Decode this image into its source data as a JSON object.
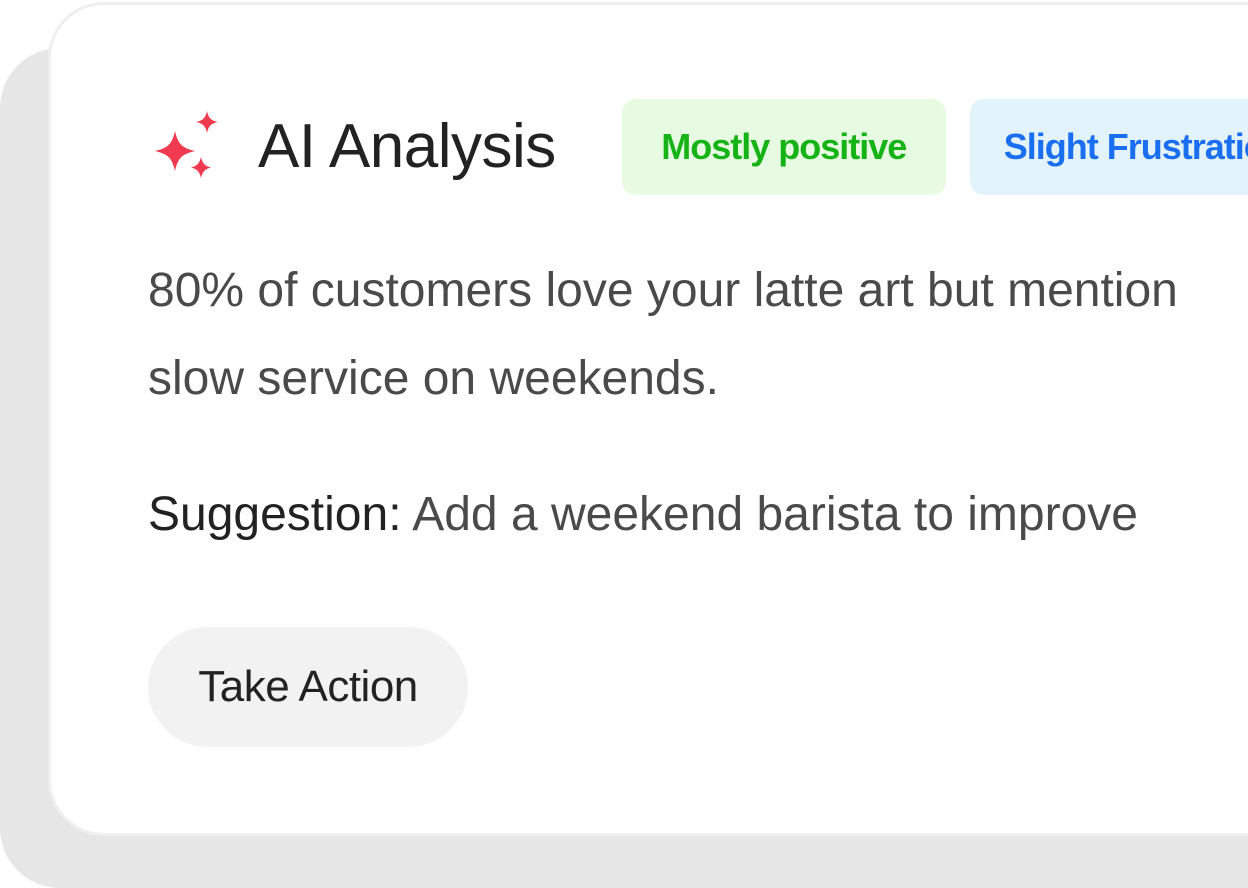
{
  "card": {
    "icon": "sparkles-icon",
    "title": "AI Analysis",
    "badges": [
      {
        "label": "Mostly positive",
        "color": "#16b316",
        "background": "#e6fbe1"
      },
      {
        "label": "Slight Frustration",
        "color": "#1a6ff0",
        "background": "#e3f3fb"
      }
    ],
    "summary_lines": [
      "80% of customers love your latte art but mention",
      "slow service on weekends."
    ],
    "suggestion_label": "Suggestion:",
    "suggestion_text": " Add a weekend barista to improve",
    "action_label": "Take Action"
  },
  "colors": {
    "accent_icon": "#f03a4f",
    "card_shadow": "#e6e6e6",
    "button_bg": "#f2f2f2"
  }
}
